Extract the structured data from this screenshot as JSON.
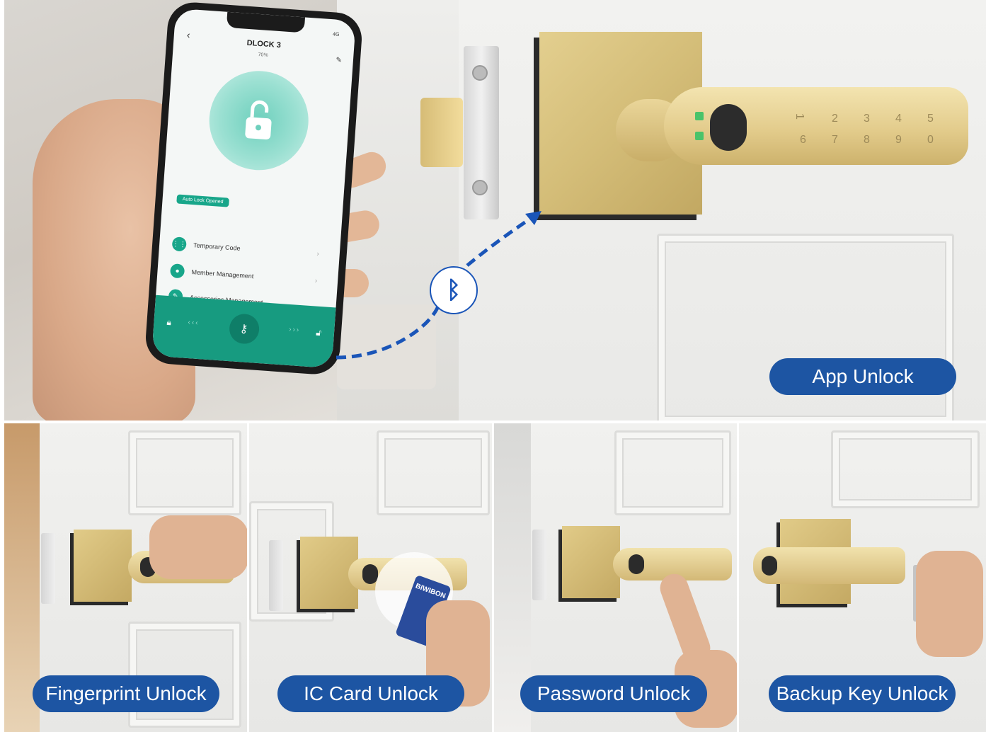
{
  "hero": {
    "phone_app": {
      "title": "DLOCK 3",
      "battery": "70%",
      "status": "4G",
      "badge": "Auto Lock Opened",
      "menu": [
        {
          "label": "Temporary Code",
          "icon": "keypad-icon"
        },
        {
          "label": "Member Management",
          "icon": "person-icon"
        },
        {
          "label": "Accessories Management",
          "icon": "wrench-icon"
        }
      ]
    },
    "keypad_digits": [
      "1",
      "2",
      "3",
      "4",
      "5",
      "6",
      "7",
      "8",
      "9",
      "0"
    ],
    "label": "App Unlock"
  },
  "methods": [
    {
      "label": "Fingerprint Unlock"
    },
    {
      "label": "IC Card Unlock",
      "card_brand": "BIWIBON"
    },
    {
      "label": "Password Unlock"
    },
    {
      "label": "Backup Key Unlock"
    }
  ],
  "colors": {
    "label_bg": "#1d55a3",
    "app_accent": "#179b80",
    "lock_gold": "#e3cc8c",
    "bluetooth_blue": "#1a55b8"
  }
}
